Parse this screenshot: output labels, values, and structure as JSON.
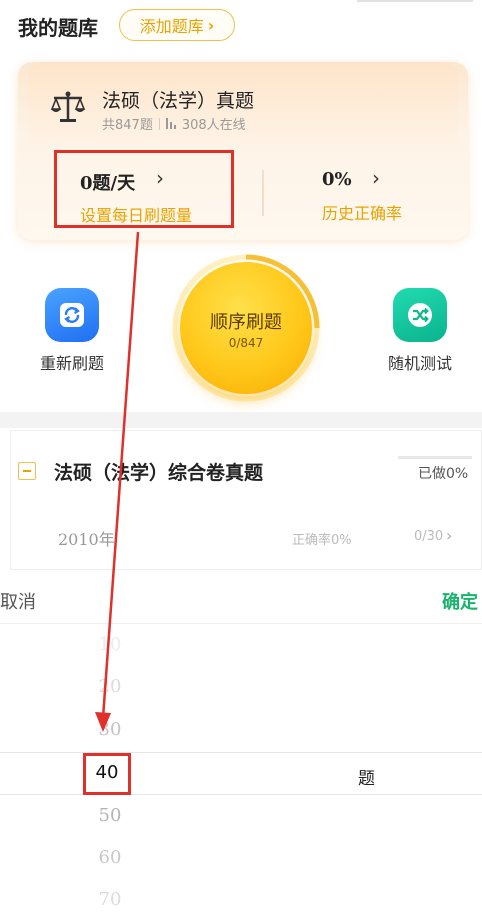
{
  "header": {
    "title": "我的题库",
    "add_button": "添加题库"
  },
  "bank": {
    "title": "法硕（法学）真题",
    "total": "共847题",
    "online": "308人在线",
    "daily_value": "0题/天",
    "daily_label": "设置每日刷题量",
    "accuracy_value": "0%",
    "accuracy_label": "历史正确率"
  },
  "actions": {
    "redo_label": "重新刷题",
    "sequential_label": "顺序刷题",
    "sequential_progress": "0/847",
    "random_label": "随机测试"
  },
  "paper": {
    "title": "法硕（法学）综合卷真题",
    "done": "已做0%",
    "year": "2010年",
    "accuracy": "正确率0%",
    "count": "0/30"
  },
  "picker": {
    "cancel": "取消",
    "confirm": "确定",
    "options": [
      "10",
      "20",
      "30",
      "40",
      "50",
      "60",
      "70"
    ],
    "selected": "40",
    "unit": "题"
  },
  "colors": {
    "accent": "#e9a300",
    "confirm": "#19b46b",
    "highlight": "#e0302a"
  }
}
